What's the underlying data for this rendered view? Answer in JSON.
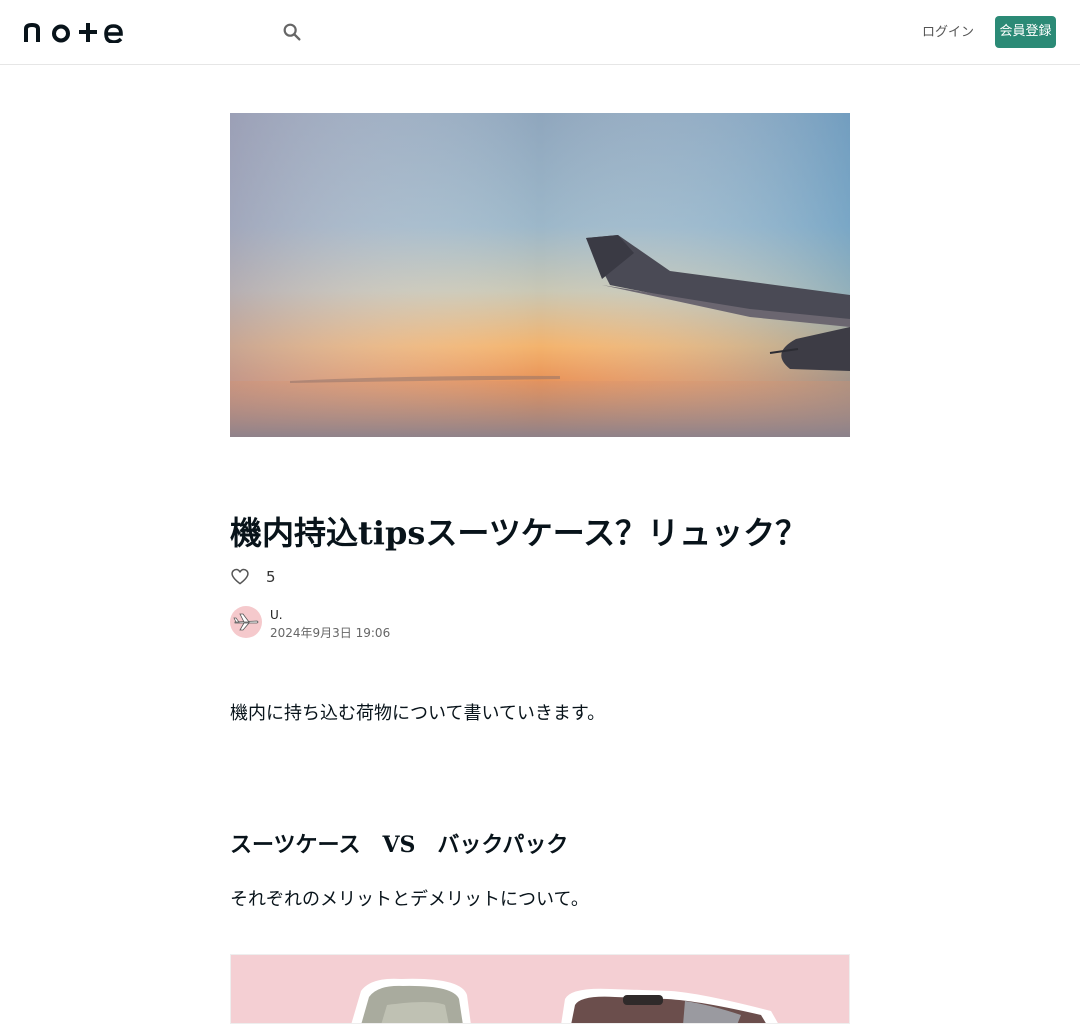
{
  "header": {
    "logo_text": "note",
    "search_icon": "search-icon",
    "login_label": "ログイン",
    "register_label": "会員登録"
  },
  "article": {
    "title": "機内持込tipsスーツケース？リュック？",
    "likes": "5",
    "author_name": "U.",
    "date": "2024年9月3日 19:06",
    "intro": "機内に持ち込む荷物について書いていきます。",
    "section_heading": "スーツケース　VS　バックパック",
    "section_text": "それぞれのメリットとデメリットについて。"
  },
  "colors": {
    "brand_green": "#2b8a76",
    "figure_bg": "#f4cfd3"
  }
}
